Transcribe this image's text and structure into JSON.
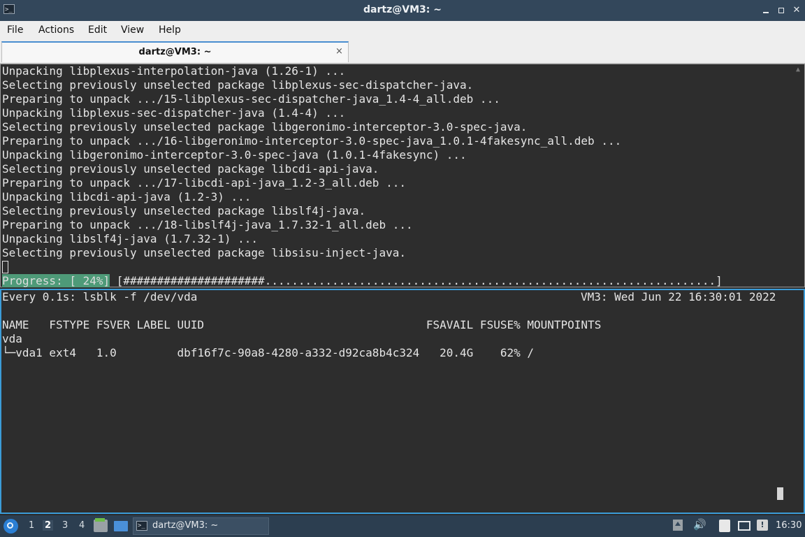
{
  "window": {
    "title": "dartz@VM3: ~",
    "app_icon_glyph": ">_"
  },
  "menu": {
    "items": [
      "File",
      "Actions",
      "Edit",
      "View",
      "Help"
    ]
  },
  "tab": {
    "label": "dartz@VM3: ~",
    "close_glyph": "×"
  },
  "top_pane": {
    "lines": [
      "Unpacking libplexus-interpolation-java (1.26-1) ...",
      "Selecting previously unselected package libplexus-sec-dispatcher-java.",
      "Preparing to unpack .../15-libplexus-sec-dispatcher-java_1.4-4_all.deb ...",
      "Unpacking libplexus-sec-dispatcher-java (1.4-4) ...",
      "Selecting previously unselected package libgeronimo-interceptor-3.0-spec-java.",
      "Preparing to unpack .../16-libgeronimo-interceptor-3.0-spec-java_1.0.1-4fakesync_all.deb ...",
      "Unpacking libgeronimo-interceptor-3.0-spec-java (1.0.1-4fakesync) ...",
      "Selecting previously unselected package libcdi-api-java.",
      "Preparing to unpack .../17-libcdi-api-java_1.2-3_all.deb ...",
      "Unpacking libcdi-api-java (1.2-3) ...",
      "Selecting previously unselected package libslf4j-java.",
      "Preparing to unpack .../18-libslf4j-java_1.7.32-1_all.deb ...",
      "Unpacking libslf4j-java (1.7.32-1) ...",
      "Selecting previously unselected package libsisu-inject-java."
    ],
    "progress_label": "Progress: [ 24%]",
    "progress_bar": "[#####################...................................................................]",
    "progress_fraction": 0.24
  },
  "bottom_pane": {
    "watch_header": "Every 0.1s: lsblk -f /dev/vda",
    "watch_status": "VM3: Wed Jun 22 16:30:01 2022",
    "table_header": "NAME   FSTYPE FSVER LABEL UUID                                 FSAVAIL FSUSE% MOUNTPOINTS",
    "rows": [
      "vda",
      "└─vda1 ext4   1.0         dbf16f7c-90a8-4280-a332-d92ca8b4c324   20.4G    62% /"
    ]
  },
  "taskbar": {
    "desktops": [
      "1",
      "2",
      "3",
      "4"
    ],
    "active_desktop": "2",
    "task_label": "dartz@VM3: ~",
    "task_icon_glyph": ">_",
    "notification_glyph": "!",
    "volume_glyph": "🔊",
    "clock": "16:30"
  },
  "colors": {
    "titlebar_bg": "#33475b",
    "terminal_bg": "#2d2d2d",
    "progress_bg": "#4e9a78",
    "active_pane_border": "#3b9cd8",
    "taskbar_bg": "#2c3e50"
  }
}
